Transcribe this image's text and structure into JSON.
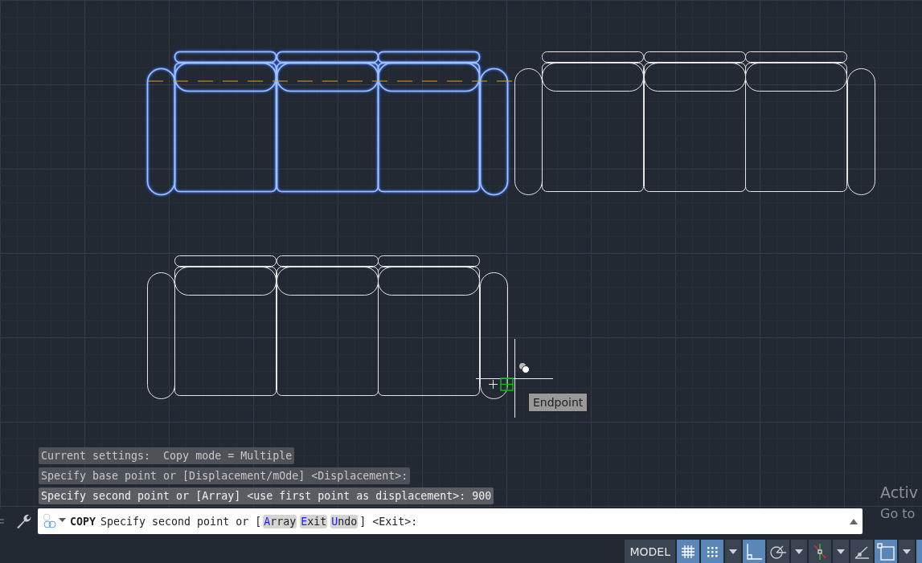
{
  "drawing": {
    "sofas": [
      {
        "selected": true
      },
      {
        "selected": false
      },
      {
        "selected": false
      }
    ],
    "snap_tooltip": "Endpoint"
  },
  "command_history": [
    {
      "text": "Current settings:  Copy mode = Multiple",
      "latest": false
    },
    {
      "text": "Specify base point or [Displacement/mOde] <Displacement>:",
      "latest": false
    },
    {
      "text": "Specify second point or [Array] <use first point as displacement>: 900",
      "latest": true
    }
  ],
  "command_line": {
    "command": "COPY",
    "prompt_start": "Specify second point or [",
    "options": [
      {
        "hotkey": "A",
        "rest": "rray"
      },
      {
        "hotkey": "E",
        "rest": "xit"
      },
      {
        "hotkey": "U",
        "rest": "ndo"
      }
    ],
    "prompt_end": "] <Exit>:"
  },
  "activation_notice": {
    "title": "Activ",
    "subtitle": "Go to"
  },
  "status_bar": [
    {
      "kind": "label",
      "text": "MODEL"
    },
    {
      "kind": "grid",
      "on": true
    },
    {
      "kind": "snap",
      "on": true
    },
    {
      "kind": "menu"
    },
    {
      "kind": "ortho",
      "on": true
    },
    {
      "kind": "polar",
      "on": false
    },
    {
      "kind": "menu"
    },
    {
      "kind": "isodraft",
      "on": false
    },
    {
      "kind": "menu"
    },
    {
      "kind": "ucs",
      "on": false
    },
    {
      "kind": "selection",
      "on": true
    },
    {
      "kind": "menu"
    },
    {
      "kind": "more",
      "on": true
    }
  ]
}
